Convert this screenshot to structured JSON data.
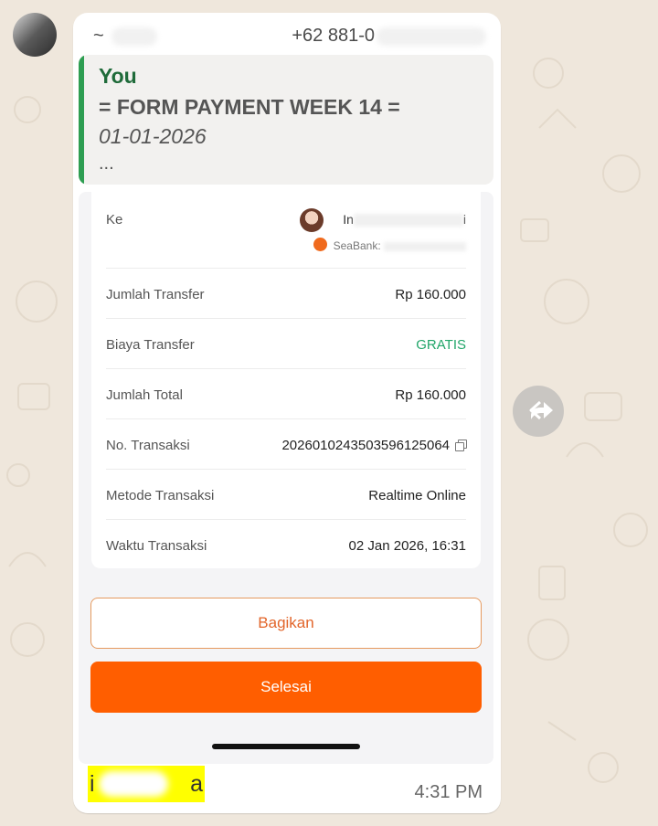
{
  "chat": {
    "sender_name_prefix": "~",
    "sender_phone": "+62 881-0",
    "quote": {
      "author": "You",
      "line1": "= FORM PAYMENT WEEK 14 =",
      "line2": "01-01-2026",
      "line3": "..."
    },
    "caption_start": "i",
    "caption_end": "a",
    "time": "4:31 PM"
  },
  "receipt": {
    "to_label": "Ke",
    "recipient_name_prefix": "In",
    "recipient_name_suffix": "i",
    "bank_label": "SeaBank:",
    "rows": [
      {
        "label": "Jumlah Transfer",
        "value": "Rp 160.000"
      },
      {
        "label": "Biaya Transfer",
        "value": "GRATIS"
      },
      {
        "label": "Jumlah Total",
        "value": "Rp 160.000"
      },
      {
        "label": "No. Transaksi",
        "value": "2026010243503596125064"
      },
      {
        "label": "Metode Transaksi",
        "value": "Realtime Online"
      },
      {
        "label": "Waktu Transaksi",
        "value": "02 Jan 2026, 16:31"
      }
    ],
    "share_button": "Bagikan",
    "done_button": "Selesai"
  },
  "icons": {
    "forward": "forward-icon",
    "copy": "copy-icon",
    "avatar": "avatar",
    "bank": "seabank-icon"
  },
  "colors": {
    "accent_orange": "#ff5e00",
    "quote_bar": "#2e9e52",
    "free_green": "#22a66a",
    "highlight": "#ffff00"
  }
}
